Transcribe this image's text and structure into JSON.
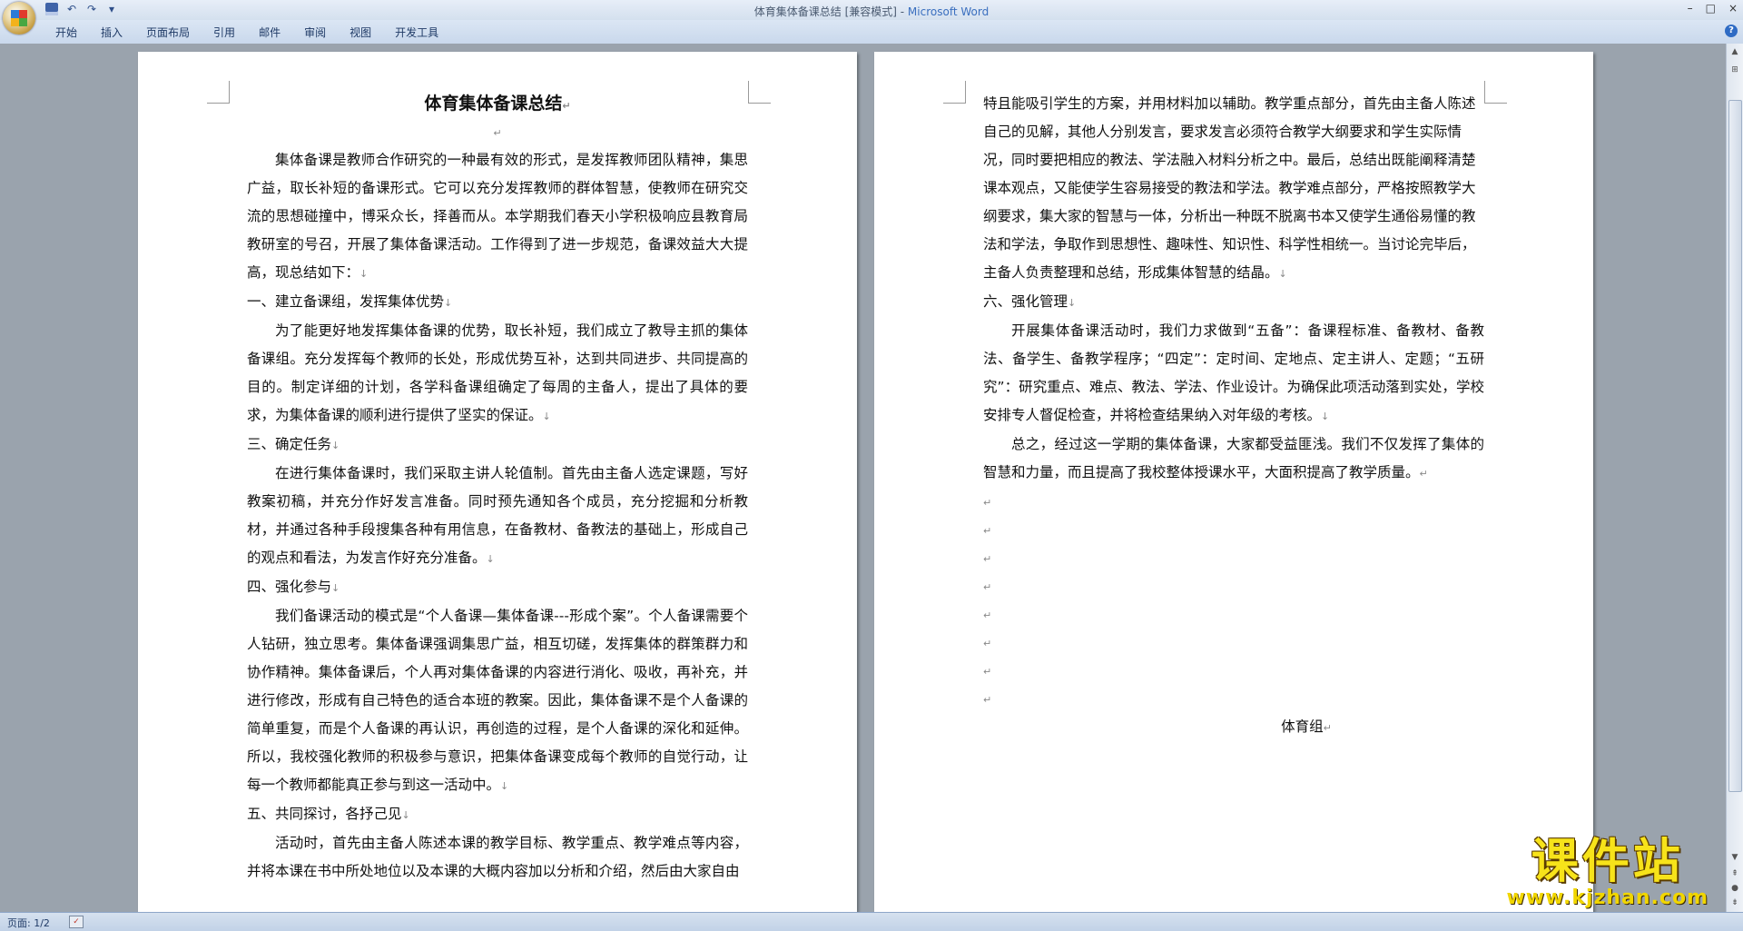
{
  "window": {
    "title": "体育集体备课总结 [兼容模式] - ",
    "app_name": "Microsoft Word",
    "controls": [
      "–",
      "□",
      "×"
    ]
  },
  "quick_access": {
    "icons": [
      "save-icon",
      "undo-icon",
      "redo-icon",
      "customize-icon"
    ],
    "glyphs": [
      "",
      "↶",
      "↷",
      "▾"
    ]
  },
  "ribbon": {
    "tabs": [
      "开始",
      "插入",
      "页面布局",
      "引用",
      "邮件",
      "审阅",
      "视图",
      "开发工具"
    ]
  },
  "document": {
    "title": "体育集体备课总结",
    "para_mark": "↵",
    "line_mark": "↓",
    "page1": [
      {
        "type": "para",
        "text": "集体备课是教师合作研究的一种最有效的形式，是发挥教师团队精神，集思广益，取长补短的备课形式。它可以充分发挥教师的群体智慧，使教师在研究交流的思想碰撞中，博采众长，择善而从。本学期我们春天小学积极响应县教育局教研室的号召，开展了集体备课活动。工作得到了进一步规范，备课效益大大提高，现总结如下：",
        "mark": "↓"
      },
      {
        "type": "heading",
        "text": "一、建立备课组，发挥集体优势",
        "mark": "↓"
      },
      {
        "type": "para",
        "text": "为了能更好地发挥集体备课的优势，取长补短，我们成立了教导主抓的集体备课组。充分发挥每个教师的长处，形成优势互补，达到共同进步、共同提高的目的。制定详细的计划，各学科备课组确定了每周的主备人，提出了具体的要求，为集体备课的顺利进行提供了坚实的保证。",
        "mark": "↓"
      },
      {
        "type": "heading",
        "text": "三、确定任务",
        "mark": "↓"
      },
      {
        "type": "para",
        "text": "在进行集体备课时，我们采取主讲人轮值制。首先由主备人选定课题，写好教案初稿，并充分作好发言准备。同时预先通知各个成员，充分挖掘和分析教材，并通过各种手段搜集各种有用信息，在备教材、备教法的基础上，形成自己的观点和看法，为发言作好充分准备。",
        "mark": "↓"
      },
      {
        "type": "heading",
        "text": "四、强化参与",
        "mark": "↓"
      },
      {
        "type": "para",
        "text": "我们备课活动的模式是“个人备课—集体备课---形成个案”。个人备课需要个人钻研，独立思考。集体备课强调集思广益，相互切磋，发挥集体的群策群力和协作精神。集体备课后，个人再对集体备课的内容进行消化、吸收，再补充，并进行修改，形成有自己特色的适合本班的教案。因此，集体备课不是个人备课的简单重复，而是个人备课的再认识，再创造的过程，是个人备课的深化和延伸。所以，我校强化教师的积极参与意识，把集体备课变成每个教师的自觉行动，让每一个教师都能真正参与到这一活动中。",
        "mark": "↓"
      },
      {
        "type": "heading",
        "text": "五、共同探讨，各抒己见",
        "mark": "↓"
      },
      {
        "type": "para",
        "text": "活动时，首先由主备人陈述本课的教学目标、教学重点、教学难点等内容，并将本课在书中所处地位以及本课的大概内容加以分析和介绍，然后由大家自由",
        "mark": ""
      }
    ],
    "page2": [
      {
        "type": "plain",
        "text": "特且能吸引学生的方案，并用材料加以辅助。教学重点部分，首先由主备人陈述自己的见解，其他人分别发言，要求发言必须符合教学大纲要求和学生实际情况，同时要把相应的教法、学法融入材料分析之中。最后，总结出既能阐释清楚课本观点，又能使学生容易接受的教法和学法。教学难点部分，严格按照教学大纲要求，集大家的智慧与一体，分析出一种既不脱离书本又使学生通俗易懂的教法和学法，争取作到思想性、趣味性、知识性、科学性相统一。当讨论完毕后，主备人负责整理和总结，形成集体智慧的结晶。",
        "mark": "↓"
      },
      {
        "type": "heading",
        "text": "六、强化管理",
        "mark": "↓"
      },
      {
        "type": "para",
        "text": "开展集体备课活动时，我们力求做到“五备”：备课程标准、备教材、备教法、备学生、备教学程序；“四定”：定时间、定地点、定主讲人、定题；“五研究”：研究重点、难点、教法、学法、作业设计。为确保此项活动落到实处，学校安排专人督促检查，并将检查结果纳入对年级的考核。",
        "mark": "↓"
      },
      {
        "type": "para",
        "text": "总之，经过这一学期的集体备课，大家都受益匪浅。我们不仅发挥了集体的智慧和力量，而且提高了我校整体授课水平，大面积提高了教学质量。",
        "mark": "↵"
      }
    ],
    "empty_marks": [
      "↵",
      "↵",
      "↵",
      "↵",
      "↵",
      "↵",
      "↵",
      "↵"
    ],
    "signature": "体育组"
  },
  "statusbar": {
    "page": "页面: 1/2"
  },
  "watermark": {
    "title": "课件站",
    "url": "www.kjzhan.com"
  }
}
